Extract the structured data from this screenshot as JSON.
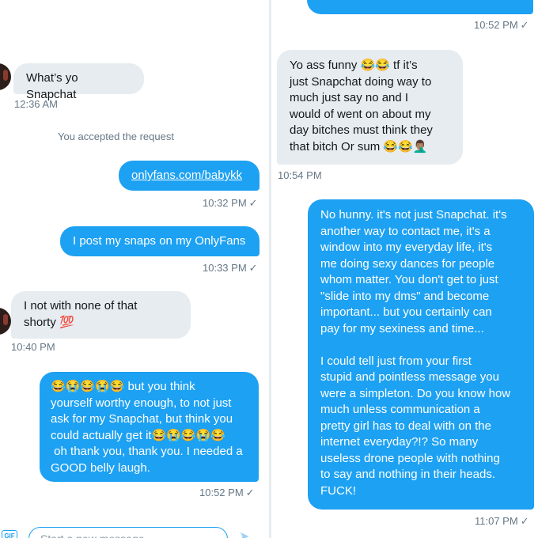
{
  "left": {
    "messages": [
      {
        "text": "What’s yo Snapchat",
        "time": "12:36 AM"
      },
      {
        "system": "You accepted the request"
      },
      {
        "text": "onlyfans.com/babykk",
        "time": "10:32 PM"
      },
      {
        "text": "I post my snaps on my OnlyFans",
        "time": "10:33 PM"
      },
      {
        "text": "I not with none of that\nshorty 💯",
        "time": "10:40 PM"
      },
      {
        "text": "😂😭😂😭😂 but you think\nyourself worthy enough, to not just\nask for my Snapchat, but think you\ncould actually get it😂😭😂😭😂\n oh thank you, thank you. I needed a\nGOOD belly laugh.",
        "time": "10:52 PM"
      }
    ],
    "composer": {
      "placeholder": "Start a new message",
      "gif_label": "GIF"
    }
  },
  "right": {
    "top_time": "10:52 PM",
    "messages": [
      {
        "text": "Yo ass funny 😂😂 tf it’s\njust Snapchat doing way to\nmuch just say no and I\nwould of went on about my\nday bitches must think they\nthat bitch Or sum 😂😂🤦🏽‍♂️",
        "time": "10:54 PM"
      },
      {
        "text": "No hunny. it's not just Snapchat. it's\nanother way to contact me, it's a\nwindow into my everyday life, it's\nme doing sexy dances for people\nwhom matter. You don't get to just\n\"slide into my dms\" and become\nimportant... but you certainly can\npay for my sexiness and time...\n\nI could tell just from your first\nstupid and pointless message you\nwere a simpleton. Do you know how\nmuch unless communication a\npretty girl has to deal with on the\ninternet everyday?!? So many\nuseless drone people with nothing\nto say and nothing in their heads.\nFUCK!",
        "time": "11:07 PM"
      }
    ]
  },
  "icons": {
    "read": "check-icon",
    "send": "send-icon",
    "gif": "gif-icon"
  },
  "colors": {
    "outgoing": "#1da1f2",
    "incoming": "#e6ecf0",
    "timestamp": "#657786"
  }
}
